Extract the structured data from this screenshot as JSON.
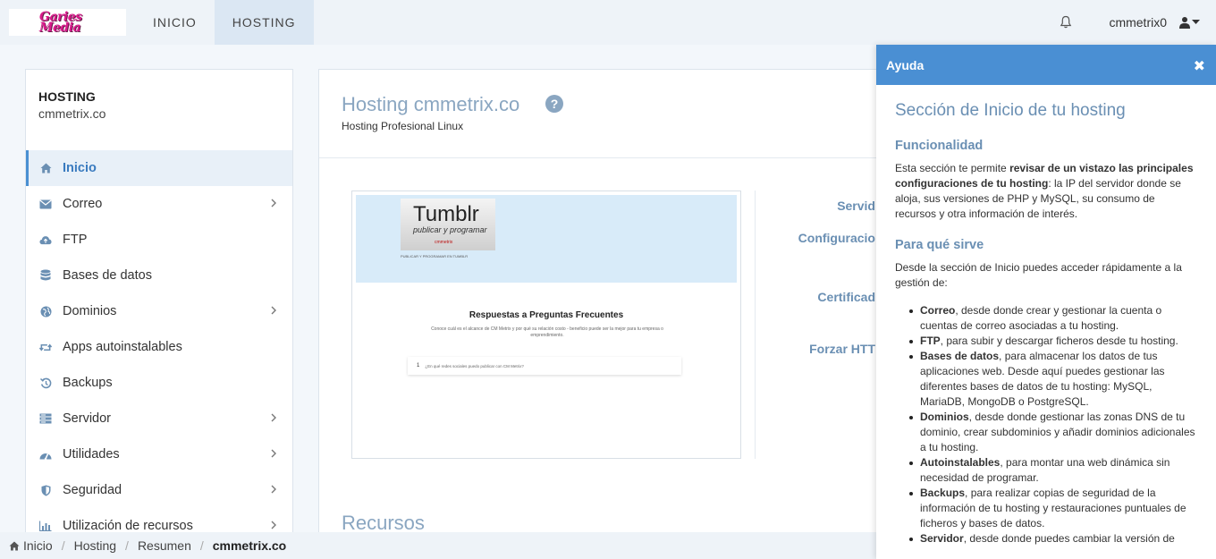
{
  "topbar": {
    "logo_text": "Garies Media",
    "nav": [
      {
        "label": "INICIO",
        "active": false
      },
      {
        "label": "HOSTING",
        "active": true
      }
    ],
    "username": "cmmetrix0"
  },
  "sidebar": {
    "title": "HOSTING",
    "domain": "cmmetrix.co",
    "items": [
      {
        "label": "Inicio",
        "icon": "home-icon",
        "active": true,
        "submenu": false
      },
      {
        "label": "Correo",
        "icon": "envelope-icon",
        "active": false,
        "submenu": true
      },
      {
        "label": "FTP",
        "icon": "cloud-upload-icon",
        "active": false,
        "submenu": false
      },
      {
        "label": "Bases de datos",
        "icon": "database-icon",
        "active": false,
        "submenu": false
      },
      {
        "label": "Dominios",
        "icon": "globe-icon",
        "active": false,
        "submenu": true
      },
      {
        "label": "Apps autoinstalables",
        "icon": "retweet-icon",
        "active": false,
        "submenu": false
      },
      {
        "label": "Backups",
        "icon": "history-icon",
        "active": false,
        "submenu": false
      },
      {
        "label": "Servidor",
        "icon": "server-icon",
        "active": false,
        "submenu": true
      },
      {
        "label": "Utilidades",
        "icon": "dashboard-icon",
        "active": false,
        "submenu": true
      },
      {
        "label": "Seguridad",
        "icon": "shield-icon",
        "active": false,
        "submenu": true
      },
      {
        "label": "Utilización de recursos",
        "icon": "bar-chart-icon",
        "active": false,
        "submenu": true
      }
    ]
  },
  "main": {
    "title": "Hosting cmmetrix.co",
    "subtitle": "Hosting Profesional Linux",
    "preview": {
      "tumblr_title": "Tumblr",
      "tumblr_sub": "publicar y programar",
      "tumblr_logo": "cmmetrix",
      "tumblr_caption": "PUBLICAR Y PROGRAMAR EN TUMBLR",
      "faq_title": "Respuestas a Preguntas Frecuentes",
      "faq_text": "Conoce cuál es el alcance de CM Metrix y por qué su relación costo - beneficio puede ser la mejor para tu empresa o emprendimiento.",
      "faq_num": "1",
      "faq_question": "¿En qué redes sociales puedo publicar con CM Metrix?"
    },
    "info_labels": [
      "Servid",
      "Configuracio",
      "Certificad",
      "Forzar HTT"
    ],
    "section_recursos": "Recursos"
  },
  "breadcrumb": [
    {
      "label": "Inicio",
      "icon": "home-icon"
    },
    {
      "label": "Hosting"
    },
    {
      "label": "Resumen"
    },
    {
      "label": "cmmetrix.co",
      "current": true
    }
  ],
  "help": {
    "header": "Ayuda",
    "title": "Sección de Inicio de tu hosting",
    "func_heading": "Funcionalidad",
    "func_text_1": "Esta sección te permite ",
    "func_text_bold": "revisar de un vistazo las principales configuraciones de tu hosting",
    "func_text_2": ": la IP del servidor donde se aloja, sus versiones de PHP y MySQL, su consumo de recursos y otra información de interés.",
    "para_heading": "Para qué sirve",
    "para_text": "Desde la sección de Inicio puedes acceder rápidamente a la gestión de:",
    "items": [
      {
        "bold": "Correo",
        "text": ", desde donde crear y gestionar la cuenta o cuentas de correo asociadas a tu hosting."
      },
      {
        "bold": "FTP",
        "text": ", para subir y descargar ficheros desde tu hosting."
      },
      {
        "bold": "Bases de datos",
        "text": ", para almacenar los datos de tus aplicaciones web. Desde aquí puedes gestionar las diferentes bases de datos de tu hosting: MySQL, MariaDB, MongoDB o PostgreSQL."
      },
      {
        "bold": "Dominios",
        "text": ", desde donde gestionar las zonas DNS de tu dominio, crear subdominios y añadir dominios adicionales a tu hosting."
      },
      {
        "bold": "Autoinstalables",
        "text": ", para montar una web dinámica sin necesidad de programar."
      },
      {
        "bold": "Backups",
        "text": ", para realizar copias de seguridad de la información de tu hosting y restauraciones puntuales de ficheros y bases de datos."
      },
      {
        "bold": "Servidor",
        "text": ", desde donde puedes cambiar la versión de"
      }
    ]
  },
  "colors": {
    "accent": "#4a8fd3",
    "heading_blue": "#6a8fb3",
    "logo_pink": "#d91b8c"
  }
}
